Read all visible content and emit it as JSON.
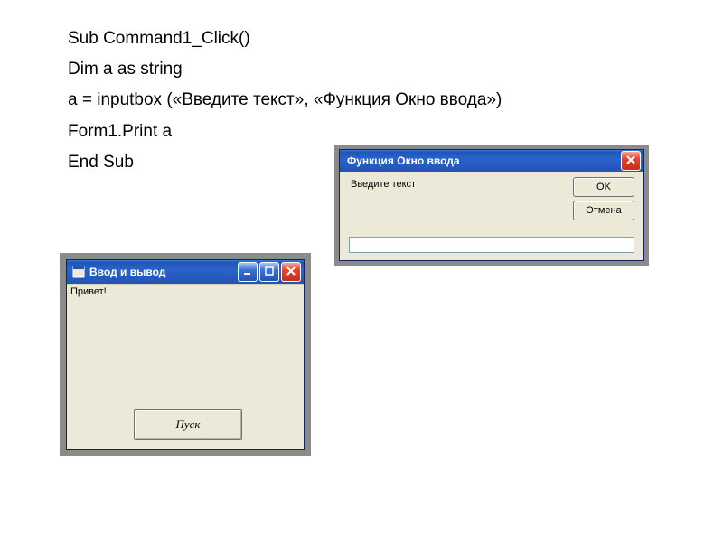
{
  "code": {
    "l1": "Sub Command1_Click()",
    "l2": "Dim a as string",
    "l3": "a = inputbox («Введите текст», «Функция Окно ввода»)",
    "l4": "Form1.Print a",
    "l5": "End Sub"
  },
  "inputbox": {
    "title": "Функция Окно ввода",
    "prompt": "Введите текст",
    "ok_label": "OK",
    "cancel_label": "Отмена",
    "value": ""
  },
  "form": {
    "title": "Ввод и вывод",
    "printed_text": "Привет!",
    "button_label": "Пуск"
  }
}
